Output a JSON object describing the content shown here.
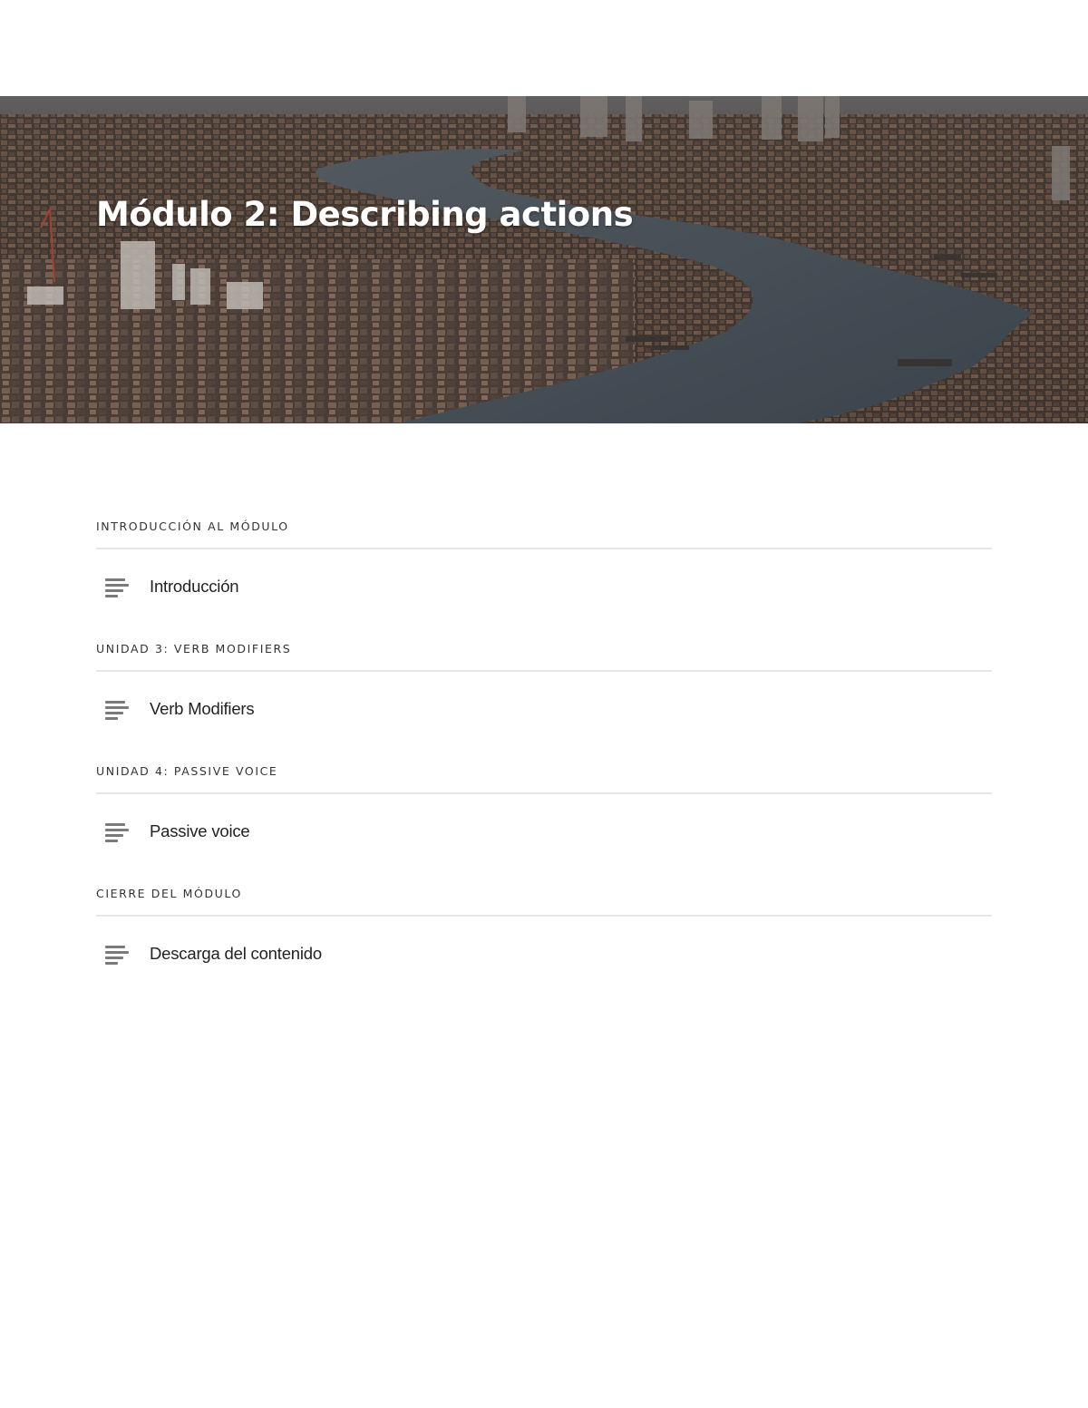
{
  "module": {
    "title": "Módulo 2: Describing actions",
    "hero_image": "aerial city river photo"
  },
  "sections": [
    {
      "header": "INTRODUCCIÓN AL MÓDULO",
      "lessons": [
        {
          "title": "Introducción",
          "icon": "text-lines-icon"
        }
      ]
    },
    {
      "header": "UNIDAD 3: VERB MODIFIERS",
      "lessons": [
        {
          "title": "Verb Modifiers",
          "icon": "text-lines-icon"
        }
      ]
    },
    {
      "header": "UNIDAD 4: PASSIVE VOICE",
      "lessons": [
        {
          "title": "Passive voice",
          "icon": "text-lines-icon"
        }
      ]
    },
    {
      "header": "CIERRE DEL MÓDULO",
      "lessons": [
        {
          "title": "Descarga del contenido",
          "icon": "text-lines-icon"
        }
      ]
    }
  ],
  "colors": {
    "title_text": "#ffffff",
    "divider": "#e6e6e6",
    "icon": "#7a7a7a",
    "river": "#4a5560"
  }
}
